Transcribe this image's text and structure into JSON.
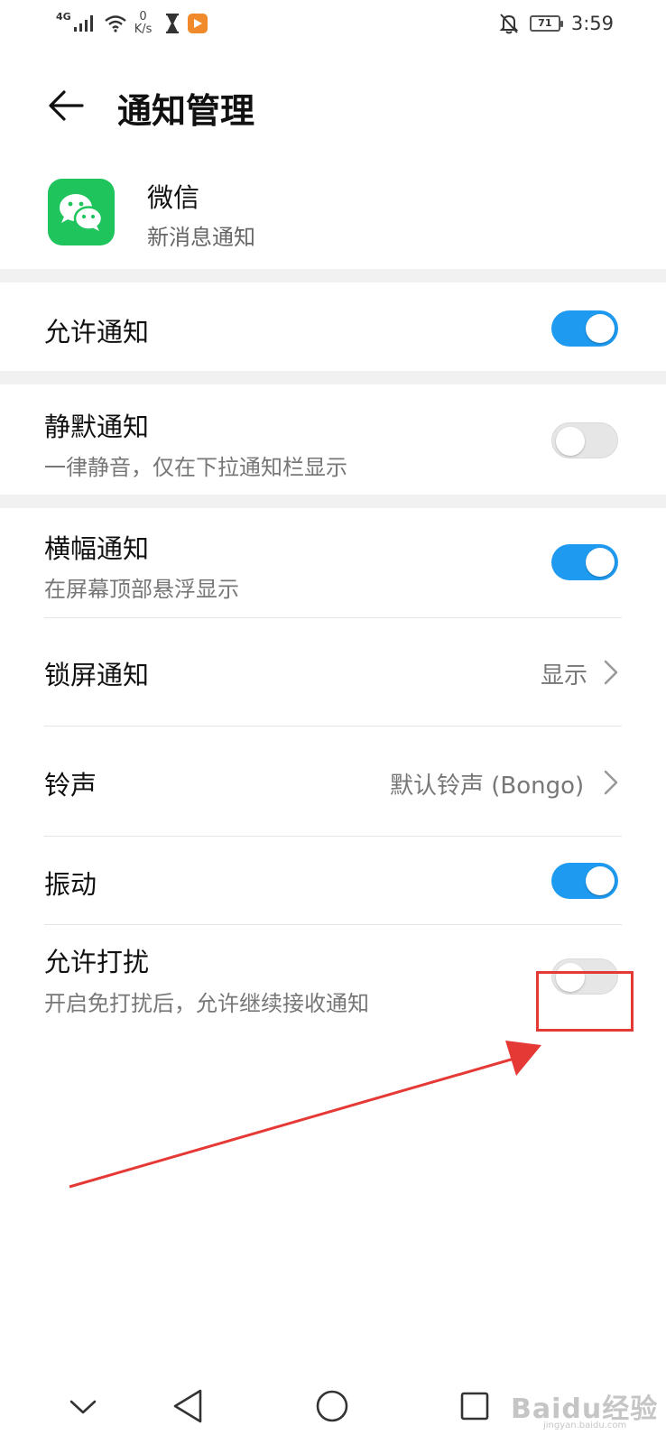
{
  "status_bar": {
    "network_type": "4G",
    "speed_value": "0",
    "speed_unit": "K/s",
    "battery": "71",
    "time": "3:59",
    "icons": [
      "signal-icon",
      "wifi-icon",
      "hourglass-icon",
      "video-app-icon",
      "mute-bell-icon",
      "battery-icon"
    ]
  },
  "header": {
    "title": "通知管理",
    "back_icon": "back-arrow-icon"
  },
  "app": {
    "name": "微信",
    "subtitle": "新消息通知",
    "icon": "wechat-icon",
    "color": "#1fc45c"
  },
  "settings": {
    "allow_notifications": {
      "title": "允许通知",
      "enabled": true
    },
    "silent": {
      "title": "静默通知",
      "subtitle": "一律静音，仅在下拉通知栏显示",
      "enabled": false
    },
    "banner": {
      "title": "横幅通知",
      "subtitle": "在屏幕顶部悬浮显示",
      "enabled": true
    },
    "lockscreen": {
      "title": "锁屏通知",
      "value": "显示"
    },
    "ringtone": {
      "title": "铃声",
      "value": "默认铃声 (Bongo)"
    },
    "vibration": {
      "title": "振动",
      "enabled": true
    },
    "dnd": {
      "title": "允许打扰",
      "subtitle": "开启免打扰后，允许继续接收通知",
      "enabled": false
    }
  },
  "colors": {
    "toggle_on": "#1e9af0",
    "toggle_off": "#e6e6e6",
    "annotation": "#e53935"
  },
  "nav_bar": {
    "icons": [
      "collapse-chevron-icon",
      "back-triangle-icon",
      "home-circle-icon",
      "recents-square-icon"
    ]
  },
  "watermark": {
    "main": "Baidu经验",
    "sub": "jingyan.baidu.com"
  }
}
